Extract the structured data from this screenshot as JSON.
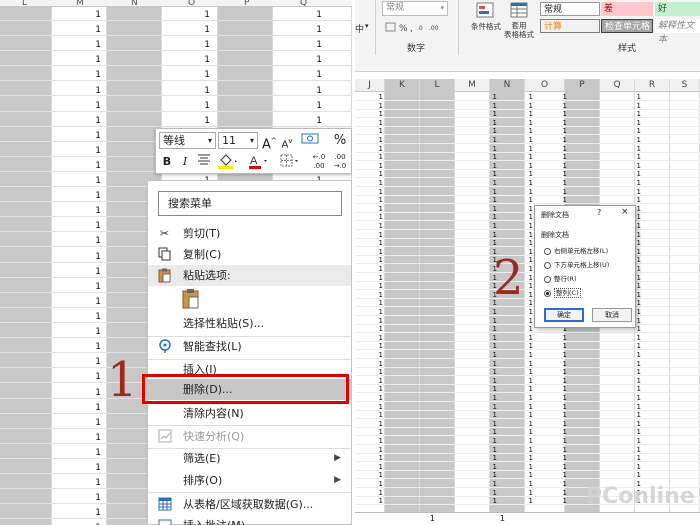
{
  "left_sheet": {
    "col_headers": [
      "L",
      "M",
      "N",
      "O",
      "P",
      "Q"
    ],
    "cell_value": "1"
  },
  "mini_toolbar": {
    "font_name": "等线",
    "font_size": "11",
    "grow_font": "A",
    "shrink_font": "A",
    "percent": "%",
    "bold": "B",
    "italic": "I",
    "inc_decimal": "←.0 .00",
    "dec_decimal": ".00 →.0"
  },
  "context_menu": {
    "search_placeholder": "搜索菜单",
    "items": [
      {
        "label": "剪切(T)",
        "icon": "scissors-icon"
      },
      {
        "label": "复制(C)",
        "icon": "copy-icon"
      },
      {
        "label": "粘贴选项:",
        "icon": "clipboard-icon"
      },
      {
        "label": "选择性粘贴(S)..."
      },
      {
        "label": "智能查找(L)",
        "icon": "smart-lookup-icon"
      },
      {
        "label": "插入(I)"
      },
      {
        "label": "删除(D)..."
      },
      {
        "label": "清除内容(N)"
      },
      {
        "label": "快速分析(Q)",
        "icon": "quick-analysis-icon"
      },
      {
        "label": "筛选(E)"
      },
      {
        "label": "排序(O)"
      },
      {
        "label": "从表格/区域获取数据(G)...",
        "icon": "table-icon"
      },
      {
        "label": "插入批注(M)"
      }
    ]
  },
  "step_labels": {
    "one": "1",
    "two": "2"
  },
  "ribbon": {
    "number_format": "常规",
    "number_group": "数字",
    "styles_group": "样式",
    "conditional_format": "条件格式",
    "table_format": "套用\n表格格式",
    "middle_label": "中",
    "styles": [
      {
        "label": "常规",
        "bg": "#ffffff",
        "fg": "#222222"
      },
      {
        "label": "差",
        "bg": "#ffc7ce",
        "fg": "#9c0006"
      },
      {
        "label": "好",
        "bg": "#c6efce",
        "fg": "#006100"
      },
      {
        "label": "计算",
        "bg": "#f2f2f2",
        "fg": "#fa7d00"
      },
      {
        "label": "检查单元格",
        "bg": "#a5a5a5",
        "fg": "#ffffff"
      },
      {
        "label": "解释性文本",
        "bg": "#ffffff",
        "fg": "#7f7f7f"
      }
    ]
  },
  "right_sheet": {
    "col_headers": [
      "J",
      "K",
      "L",
      "M",
      "N",
      "O",
      "P",
      "Q",
      "R",
      "S"
    ],
    "cell_value": "1"
  },
  "dialog": {
    "title": "删除文档",
    "help": "?",
    "close": "×",
    "section": "删除文档",
    "options": [
      "右侧单元格左移(L)",
      "下方单元格上移(U)",
      "整行(R)",
      "整列(C)"
    ],
    "selected_option": 3,
    "ok": "确定",
    "cancel": "取消"
  },
  "watermark": "PConline"
}
